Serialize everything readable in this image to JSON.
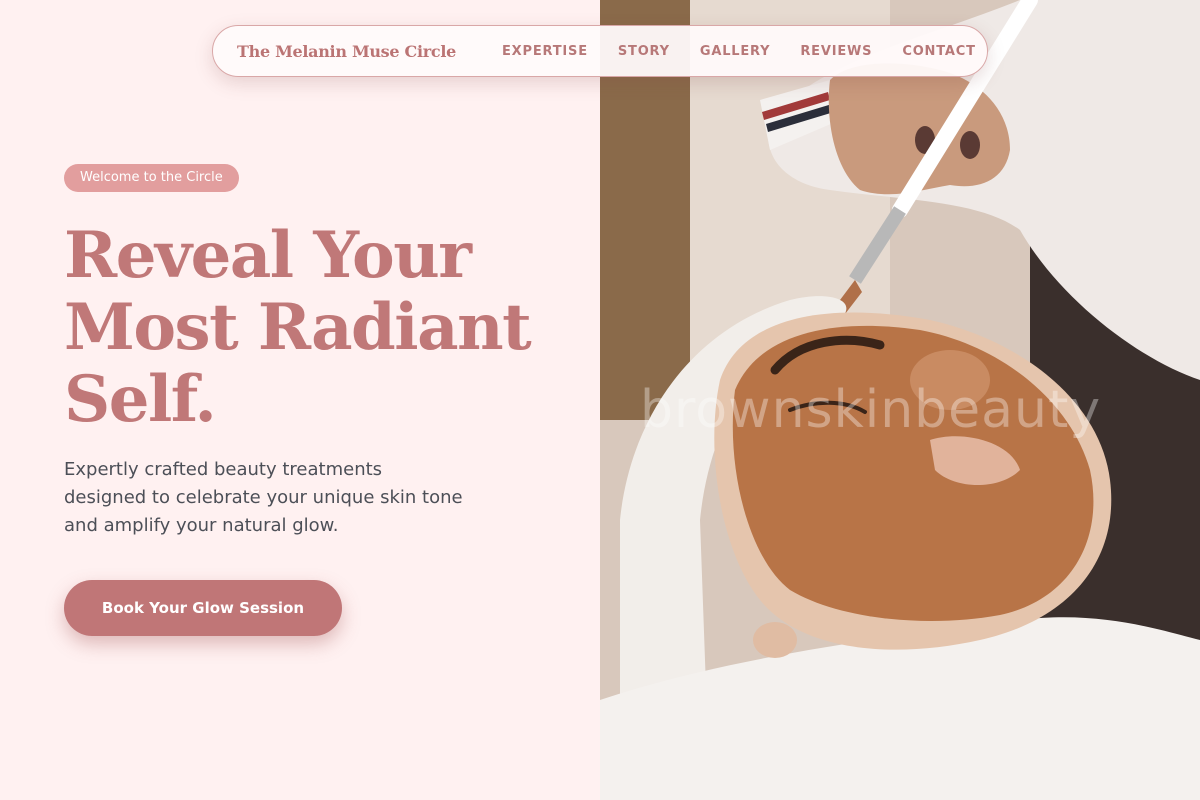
{
  "nav": {
    "brand": "The Melanin Muse Circle",
    "links": [
      "EXPERTISE",
      "STORY",
      "GALLERY",
      "REVIEWS",
      "CONTACT"
    ]
  },
  "hero": {
    "badge": "Welcome to the Circle",
    "headline": [
      "Reveal Your",
      "Most Radiant",
      "Self."
    ],
    "subtext": [
      "Expertly crafted beauty treatments",
      "designed to celebrate your unique skin tone",
      "and amplify your natural glow."
    ],
    "cta": "Book Your Glow Session"
  },
  "image": {
    "watermark": "brownskinbeauty"
  },
  "colors": {
    "background": "#fff1f1",
    "accent": "#c07878",
    "badge": "#e29e9e",
    "button": "#c07677",
    "body_text": "#4c4f57"
  }
}
